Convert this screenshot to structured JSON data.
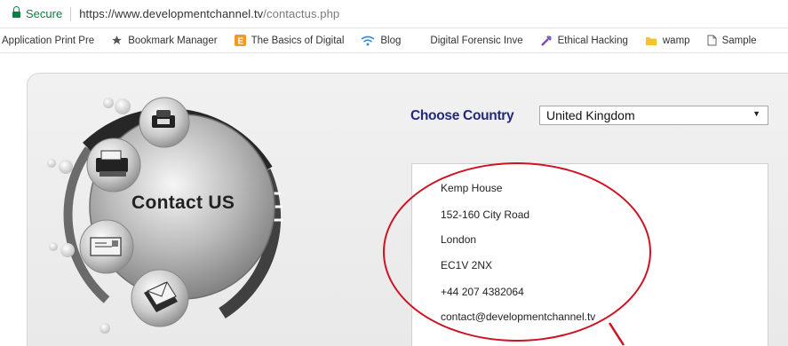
{
  "browser": {
    "secure_label": "Secure",
    "url_domain": "https://www.developmentchannel.tv",
    "url_path": "/contactus.php",
    "bookmarks": [
      {
        "label": "Application Print Pre",
        "icon": "none"
      },
      {
        "label": "Bookmark Manager",
        "icon": "star-icon"
      },
      {
        "label": "The Basics of Digital",
        "icon": "orange-square-icon"
      },
      {
        "label": "Blog",
        "icon": "wifi-icon"
      },
      {
        "label": "Digital Forensic Inve",
        "icon": "none"
      },
      {
        "label": "Ethical Hacking",
        "icon": "tool-icon"
      },
      {
        "label": "wamp",
        "icon": "folder-icon"
      },
      {
        "label": "Sample",
        "icon": "page-icon"
      }
    ]
  },
  "page": {
    "title": "Contact US",
    "choose_country_label": "Choose Country",
    "country_value": "United Kingdom",
    "address_lines": [
      "Kemp House",
      "152-160 City Road",
      "London",
      "EC1V 2NX",
      "+44 207 4382064",
      "contact@developmentchannel.tv"
    ]
  },
  "colors": {
    "secure_green": "#0b8043",
    "heading_navy": "#23297a",
    "annotation_red": "#cf1222"
  }
}
